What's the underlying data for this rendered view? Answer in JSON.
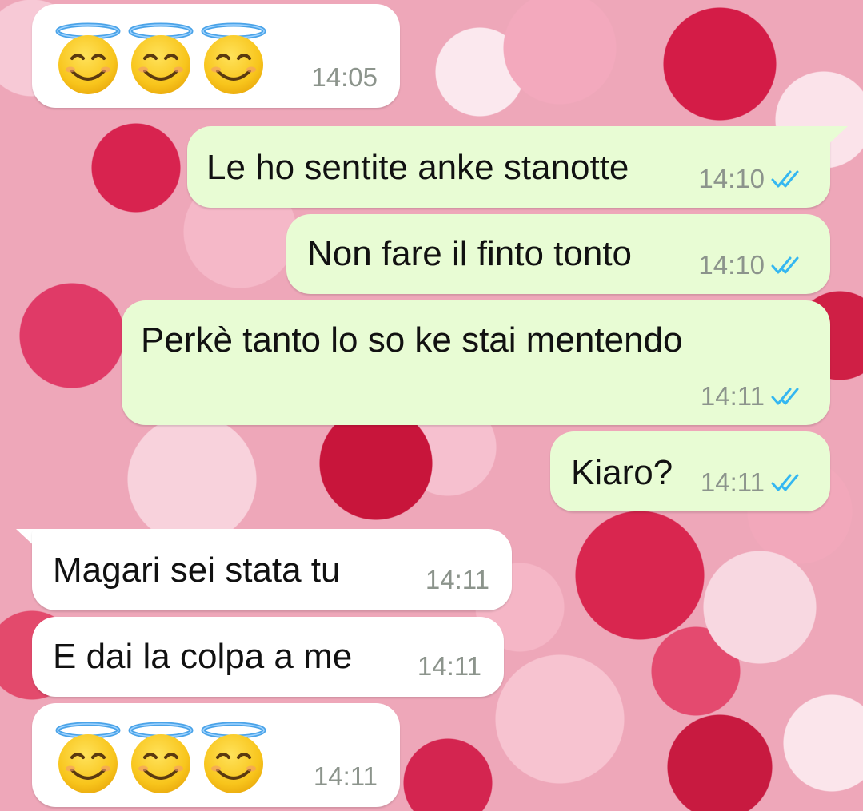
{
  "messages": [
    {
      "id": "m1",
      "direction": "in",
      "emoji": "smiling-face-with-halo",
      "emoji_count": 3,
      "time": "14:05"
    },
    {
      "id": "m2",
      "direction": "out",
      "text": "Le ho sentite anke stanotte",
      "time": "14:10",
      "status": "read"
    },
    {
      "id": "m3",
      "direction": "out",
      "text": "Non fare il finto tonto",
      "time": "14:10",
      "status": "read"
    },
    {
      "id": "m4",
      "direction": "out",
      "text": "Perkè tanto lo so ke stai mentendo",
      "time": "14:11",
      "status": "read"
    },
    {
      "id": "m5",
      "direction": "out",
      "text": "Kiaro?",
      "time": "14:11",
      "status": "read"
    },
    {
      "id": "m6",
      "direction": "in",
      "text": "Magari sei stata tu",
      "time": "14:11"
    },
    {
      "id": "m7",
      "direction": "in",
      "text": "E dai la colpa a me",
      "time": "14:11"
    },
    {
      "id": "m8",
      "direction": "in",
      "emoji": "smiling-face-with-halo",
      "emoji_count": 3,
      "time": "14:11"
    }
  ],
  "colors": {
    "incoming_bubble": "#ffffff",
    "outgoing_bubble": "#e8fcd4",
    "read_ticks": "#34b7f1",
    "timestamp": "#8c948c"
  },
  "icons": {
    "read_receipt": "double-check-icon",
    "emoji": "smiling-face-with-halo-icon"
  }
}
